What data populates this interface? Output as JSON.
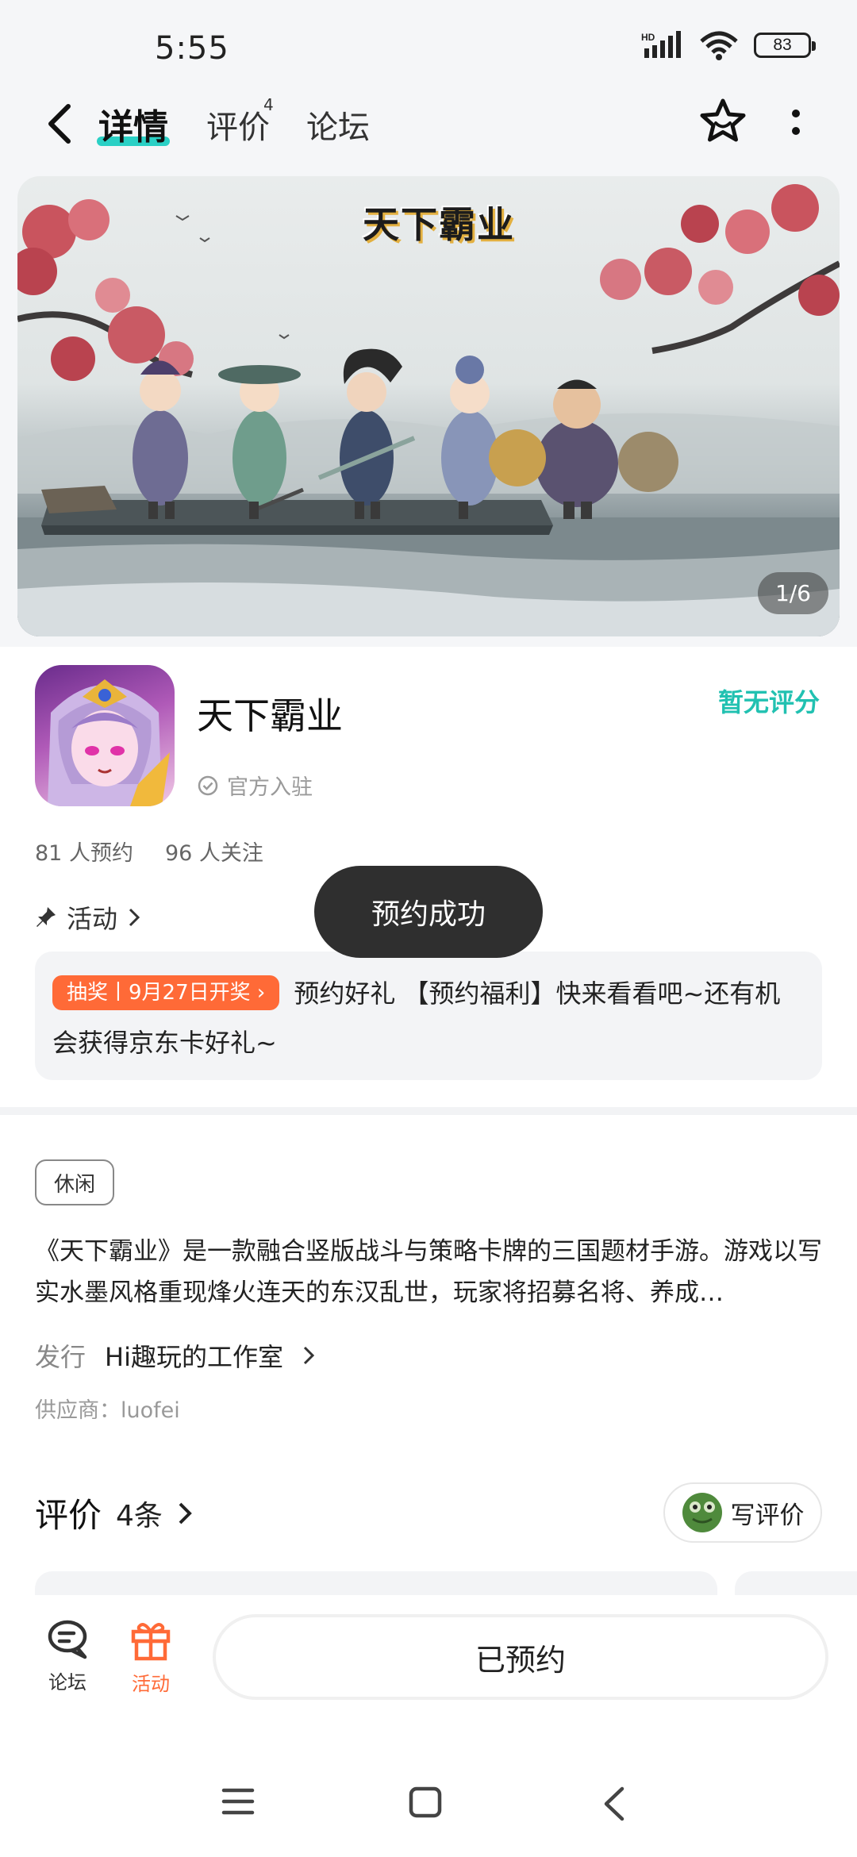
{
  "status_bar": {
    "time": "5:55",
    "network_label": "HD",
    "battery": "83"
  },
  "header": {
    "tabs": [
      {
        "label": "详情",
        "active": true
      },
      {
        "label": "评价",
        "badge": "4"
      },
      {
        "label": "论坛"
      }
    ],
    "accent_color": "#2ad0c5"
  },
  "banner": {
    "logo_text": "天下霸业",
    "page_indicator": "1/6"
  },
  "app": {
    "name": "天下霸业",
    "rating": "暂无评分",
    "official_label": "官方入驻",
    "reservations": "81 人预约",
    "followers": "96 人关注"
  },
  "activity": {
    "label": "活动",
    "lottery_tag": "抽奖丨9月27日开奖",
    "text": "预约好礼 【预约福利】快来看看吧~还有机会获得京东卡好礼~",
    "tag_color": "#ff6a37"
  },
  "toast": "预约成功",
  "details": {
    "genre": "休闲",
    "description": "《天下霸业》是一款融合竖版战斗与策略卡牌的三国题材手游。游戏以写实水墨风格重现烽火连天的东汉乱世，玩家将招募名将、养成…",
    "publisher_label": "发行",
    "publisher": "Hi趣玩的工作室",
    "supplier": "供应商：luofei"
  },
  "reviews": {
    "title": "评价",
    "count": "4条",
    "write_label": "写评价"
  },
  "bottom_bar": {
    "forum_label": "论坛",
    "activity_label": "活动",
    "reserved_label": "已预约",
    "activity_color": "#ff6a37"
  }
}
